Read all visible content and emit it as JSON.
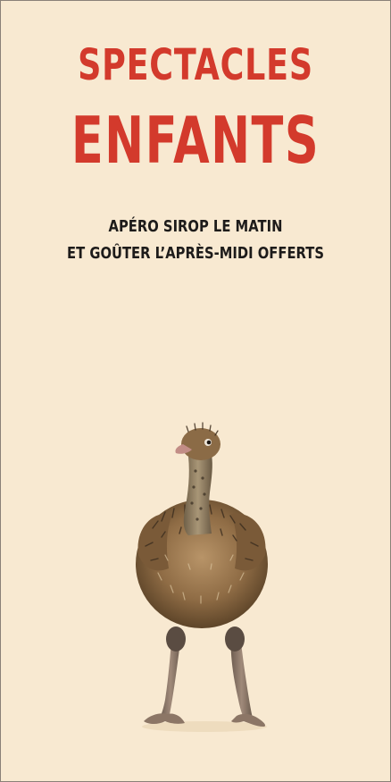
{
  "poster": {
    "title_line_1": "SPECTACLES",
    "title_line_2": "ENFANTS",
    "subtitle_line_1": "APÉRO SIROP LE MATIN",
    "subtitle_line_2": "ET GOÛTER L’APRÈS-MIDI OFFERTS",
    "illustration": "ostrich-chick",
    "colors": {
      "background": "#f8e9d1",
      "title": "#d33a2c",
      "subtitle": "#1d1b1a"
    }
  }
}
